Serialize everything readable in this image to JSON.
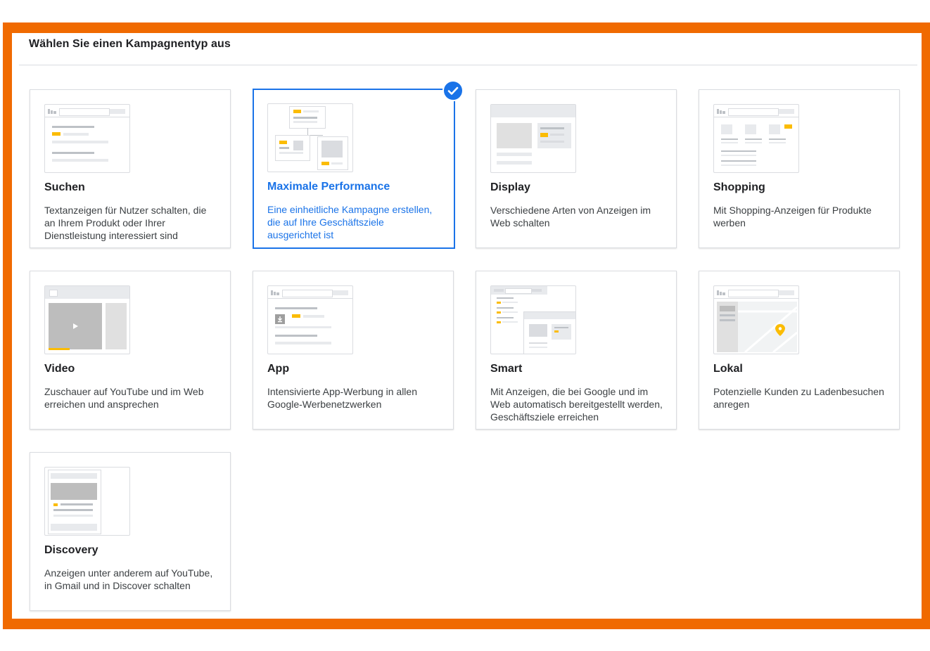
{
  "header": {
    "title": "Wählen Sie einen Kampagnentyp aus"
  },
  "colors": {
    "frame": "#f06a00",
    "selected": "#1a73e8",
    "accent_yellow": "#fbbc04"
  },
  "campaign_types": [
    {
      "key": "search",
      "name": "Suchen",
      "description": "Textanzeigen für Nutzer schalten, die an Ihrem Produkt oder Ihrer Dienstleistung interessiert sind",
      "selected": false,
      "icon": "search-ad-illustration"
    },
    {
      "key": "pmax",
      "name": "Maximale Performance",
      "description": "Eine einheitliche Kampagne erstellen, die auf Ihre Geschäftsziele ausgerichtet ist",
      "selected": true,
      "icon": "performance-max-illustration"
    },
    {
      "key": "display",
      "name": "Display",
      "description": "Verschiedene Arten von Anzeigen im Web schalten",
      "selected": false,
      "icon": "display-ad-illustration"
    },
    {
      "key": "shopping",
      "name": "Shopping",
      "description": "Mit Shopping-Anzeigen für Produkte werben",
      "selected": false,
      "icon": "shopping-ad-illustration"
    },
    {
      "key": "video",
      "name": "Video",
      "description": "Zuschauer auf YouTube und im Web erreichen und ansprechen",
      "selected": false,
      "icon": "video-ad-illustration"
    },
    {
      "key": "app",
      "name": "App",
      "description": "Intensivierte App-Werbung in allen Google-Werbenetzwerken",
      "selected": false,
      "icon": "app-ad-illustration"
    },
    {
      "key": "smart",
      "name": "Smart",
      "description": "Mit Anzeigen, die bei Google und im Web automatisch bereitgestellt werden, Geschäftsziele erreichen",
      "selected": false,
      "icon": "smart-ad-illustration"
    },
    {
      "key": "local",
      "name": "Lokal",
      "description": "Potenzielle Kunden zu Ladenbesuchen anregen",
      "selected": false,
      "icon": "local-ad-illustration"
    },
    {
      "key": "discovery",
      "name": "Discovery",
      "description": "Anzeigen unter anderem auf YouTube, in Gmail und in Discover schalten",
      "selected": false,
      "icon": "discovery-ad-illustration"
    }
  ]
}
